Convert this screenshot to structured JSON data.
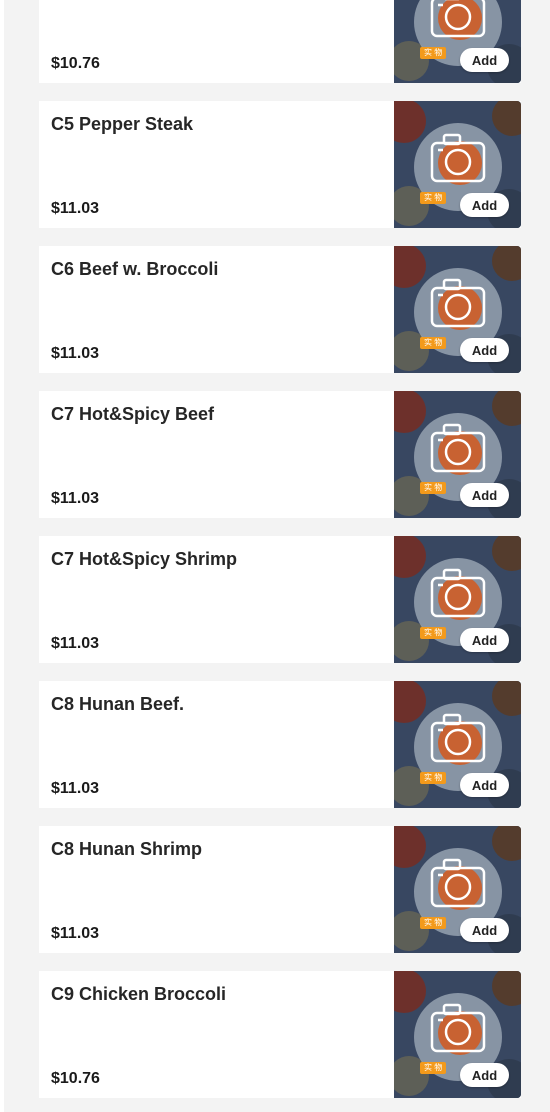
{
  "colors": {
    "panel_background": "#f3f3f3",
    "card_background": "#ffffff",
    "badge_orange": "#f39a1b"
  },
  "menu": {
    "items": [
      {
        "name": "",
        "price": "$10.76",
        "badge": "实 物",
        "add_label": "Add"
      },
      {
        "name": "C5 Pepper Steak",
        "price": "$11.03",
        "badge": "实 物",
        "add_label": "Add"
      },
      {
        "name": "C6 Beef w. Broccoli",
        "price": "$11.03",
        "badge": "实 物",
        "add_label": "Add"
      },
      {
        "name": "C7 Hot&Spicy Beef",
        "price": "$11.03",
        "badge": "实 物",
        "add_label": "Add"
      },
      {
        "name": "C7 Hot&Spicy Shrimp",
        "price": "$11.03",
        "badge": "实 物",
        "add_label": "Add"
      },
      {
        "name": "C8 Hunan Beef.",
        "price": "$11.03",
        "badge": "实 物",
        "add_label": "Add"
      },
      {
        "name": "C8 Hunan Shrimp",
        "price": "$11.03",
        "badge": "实 物",
        "add_label": "Add"
      },
      {
        "name": "C9 Chicken Broccoli",
        "price": "$10.76",
        "badge": "实 物",
        "add_label": "Add"
      }
    ]
  }
}
